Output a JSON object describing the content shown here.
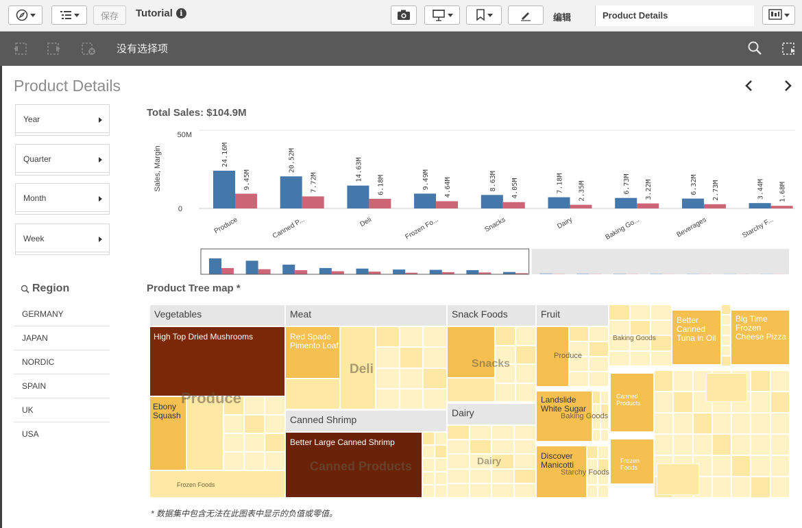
{
  "toolbar": {
    "save_label": "保存",
    "app_title": "Tutorial",
    "edit_label": "编辑",
    "sheet_select": "Product Details"
  },
  "selection_bar": {
    "text": "没有选择项"
  },
  "sheet": {
    "title": "Product Details"
  },
  "filters": [
    {
      "label": "Year"
    },
    {
      "label": "Quarter"
    },
    {
      "label": "Month"
    },
    {
      "label": "Week"
    }
  ],
  "region": {
    "title": "Region",
    "items": [
      "GERMANY",
      "JAPAN",
      "NORDIC",
      "SPAIN",
      "UK",
      "USA"
    ]
  },
  "chart_data": {
    "type": "bar",
    "title": "Total Sales: $104.9M",
    "ylabel": "Sales, Margin",
    "ylim": [
      0,
      50
    ],
    "yticks": [
      "50M",
      "0"
    ],
    "categories": [
      "Produce",
      "Canned P...",
      "Deli",
      "Frozen Fo...",
      "Snacks",
      "Dairy",
      "Baking Go...",
      "Beverages",
      "Starchy F..."
    ],
    "series": [
      {
        "values": [
          24.16,
          20.52,
          14.63,
          9.49,
          8.63,
          7.18,
          6.73,
          6.32,
          3.44
        ],
        "color": "#4477aa"
      },
      {
        "values": [
          9.45,
          7.72,
          6.18,
          4.64,
          4.05,
          2.35,
          3.22,
          2.73,
          1.68
        ],
        "color": "#cc6677"
      }
    ],
    "value_labels": [
      [
        "24.16M",
        "20.52M",
        "14.63M",
        "9.49M",
        "8.63M",
        "7.18M",
        "6.73M",
        "6.32M",
        "3.44M"
      ],
      [
        "9.45M",
        "7.72M",
        "6.18M",
        "4.64M",
        "4.05M",
        "2.35M",
        "3.22M",
        "2.73M",
        "1.68M"
      ]
    ],
    "minimap": {
      "blue": [
        24.16,
        20.52,
        14.63,
        9.49,
        8.63,
        7.18,
        6.73,
        6.32,
        3.44,
        1.6,
        1.2,
        1.0,
        0.8,
        0.6,
        0.5,
        0.4
      ],
      "red": [
        9.45,
        7.72,
        6.18,
        4.64,
        4.05,
        2.35,
        3.22,
        2.73,
        1.68,
        0.7,
        0.5,
        0.4,
        0.3,
        0.3,
        0.2,
        0.2
      ],
      "visible_count": 9
    }
  },
  "treemap": {
    "title": "Product Tree map *",
    "headers": [
      "Vegetables",
      "Meat",
      "Snack Foods",
      "Fruit",
      "Canned Shrimp",
      "Dairy"
    ],
    "leaf_labels": {
      "high_top_mushrooms": "High Top Dried Mushrooms",
      "ebony_squash": "Ebony Squash",
      "frozen_foods_small": "Frozen Foods",
      "red_spade_loaf": "Red Spade Pimento Loaf",
      "better_large_shrimp": "Better Large Canned Shrimp",
      "landslide_sugar": "Landslide White Sugar",
      "discover_manicotti": "Discover Manicotti",
      "better_tuna": "Better Canned Tuna in Oil",
      "big_time_pizza": "Big Time Frozen Cheese Pizza",
      "canned_products_small": "Canned Products",
      "frozen_foods_small_2": "Frozen Foods"
    },
    "group_labels": {
      "produce": "Produce",
      "deli": "Deli",
      "canned_products": "Canned Products",
      "snacks": "Snacks",
      "dairy": "Dairy",
      "produce_small": "Produce",
      "baking_goods": "Baking Goods",
      "baking_goods_2": "Baking Goods",
      "starchy_foods": "Starchy Foods",
      "canned_products_2": "Canned Products",
      "frozen_foods_2": "Frozen Foods"
    },
    "colors": {
      "dark": "#7a2808",
      "darker": "#6a2208",
      "mid": "#f5c050",
      "light": "#fde8a4",
      "lighter": "#fff2c4"
    }
  },
  "footnote": "* 数据集中包含无法在此图表中显示的负值或零值。"
}
